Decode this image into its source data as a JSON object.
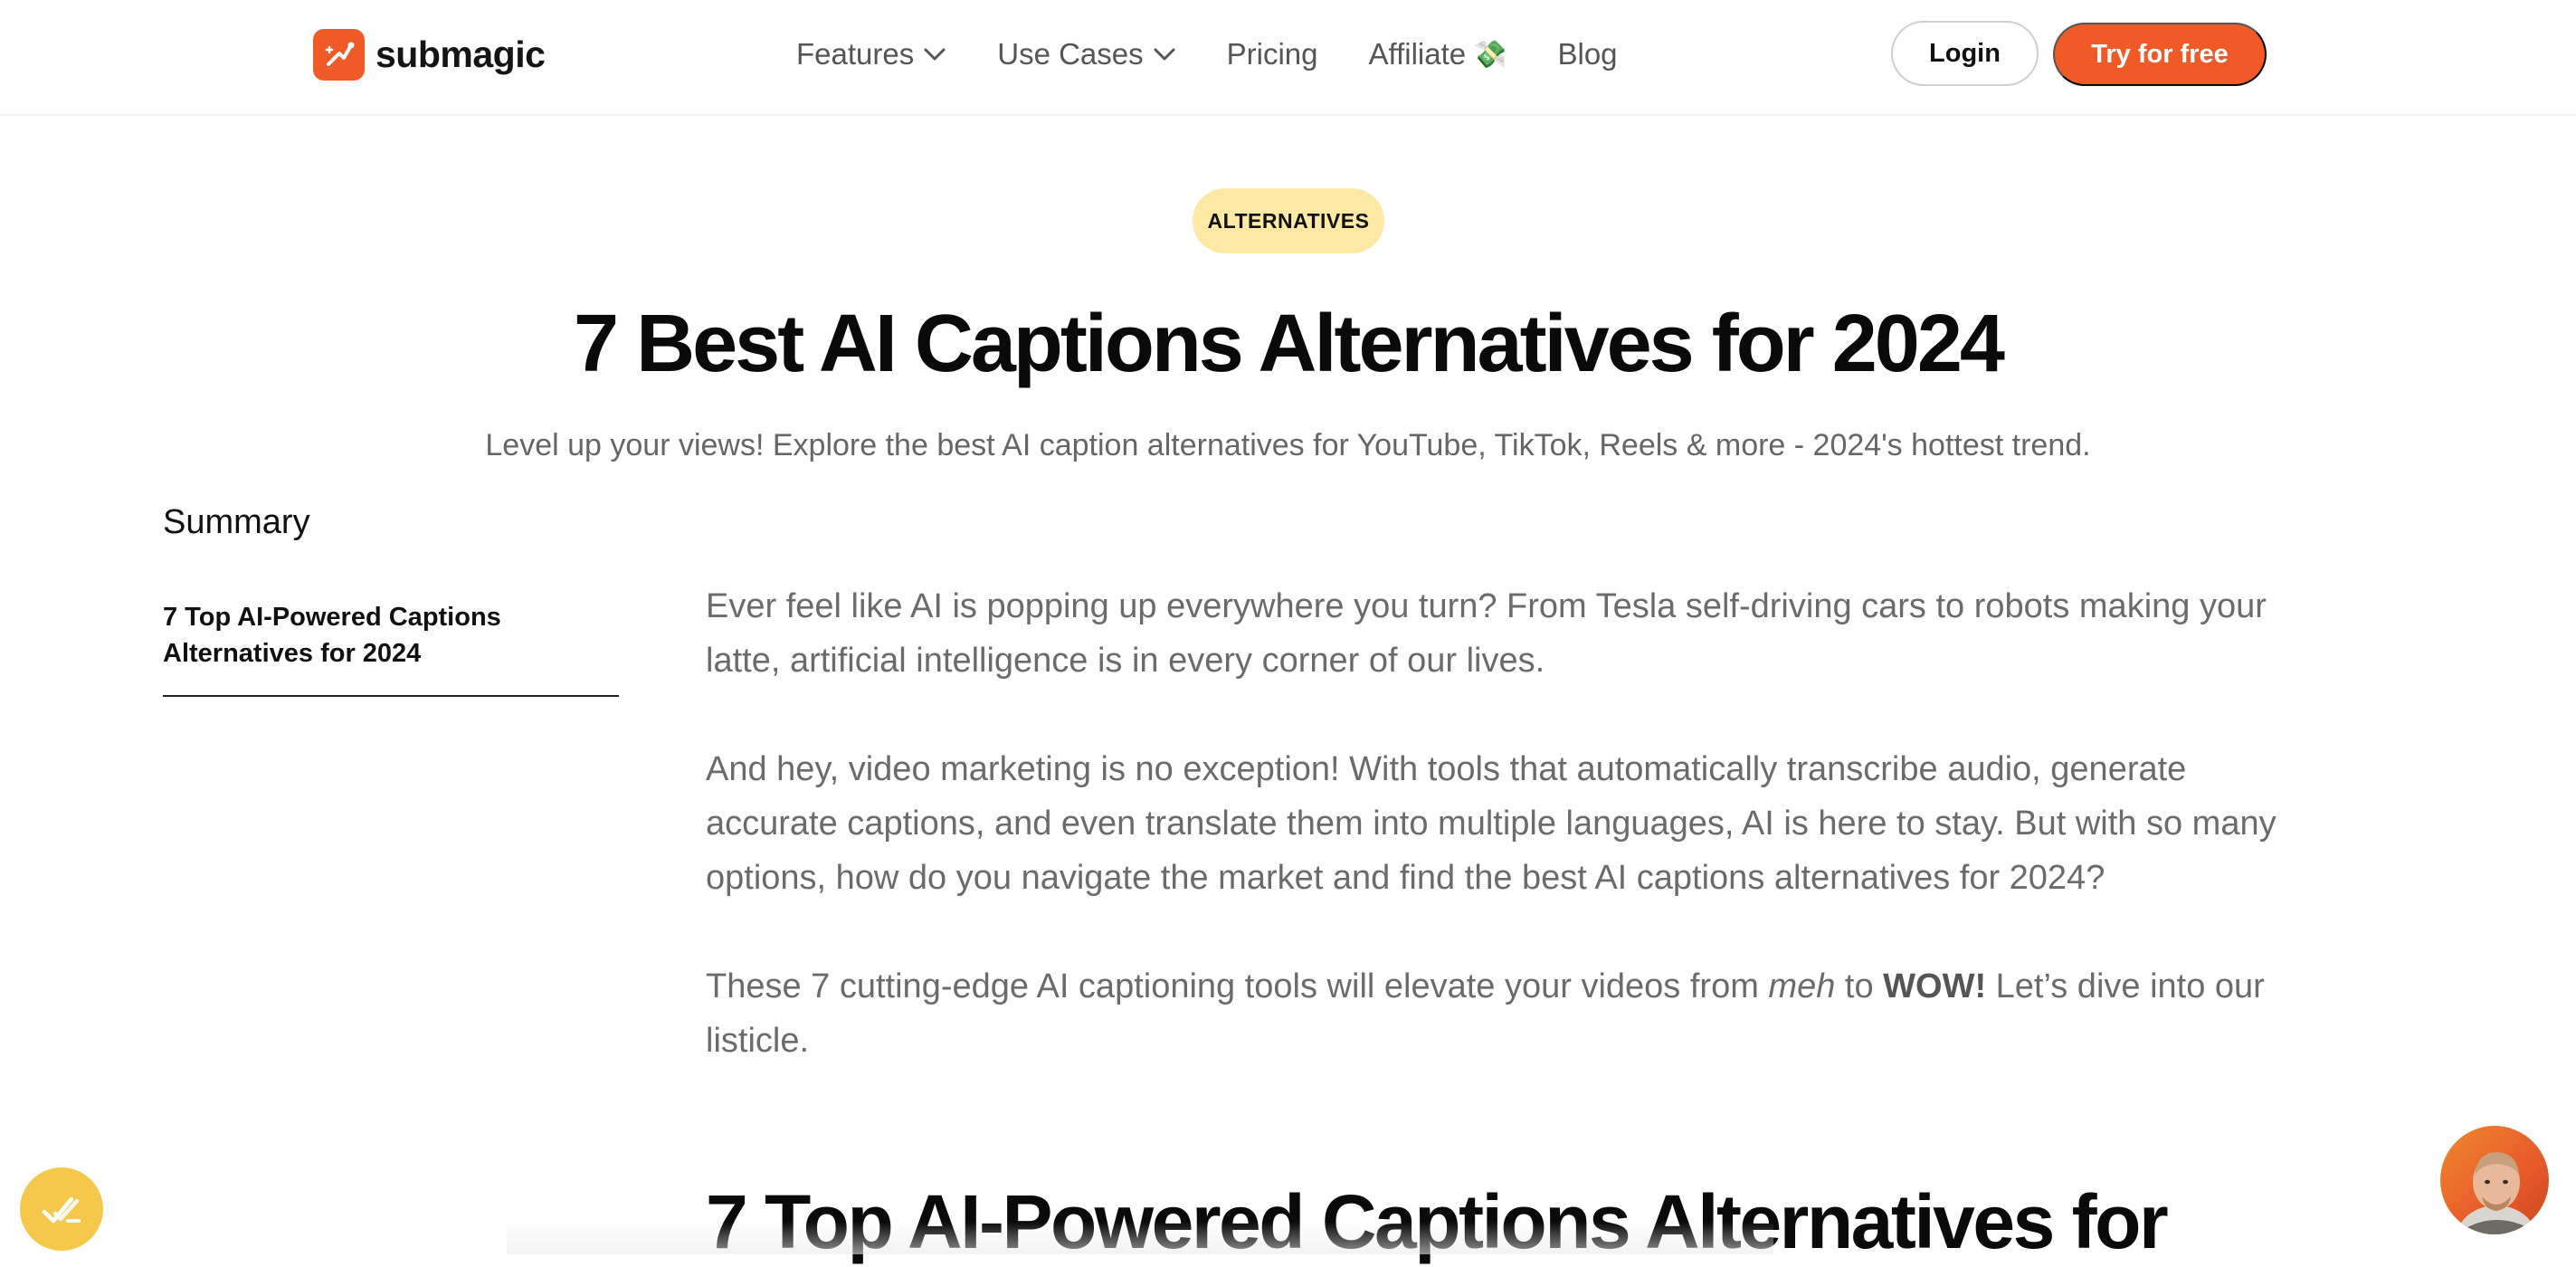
{
  "header": {
    "brand": "submagic",
    "nav": [
      {
        "label": "Features",
        "has_dropdown": true
      },
      {
        "label": "Use Cases",
        "has_dropdown": true
      },
      {
        "label": "Pricing",
        "has_dropdown": false
      },
      {
        "label": "Affiliate",
        "has_dropdown": false,
        "emoji": "💸"
      },
      {
        "label": "Blog",
        "has_dropdown": false
      }
    ],
    "login_label": "Login",
    "cta_label": "Try for free"
  },
  "hero": {
    "badge": "ALTERNATIVES",
    "title": "7 Best AI Captions Alternatives for 2024",
    "subtitle": "Level up your views! Explore the best AI caption alternatives for YouTube, TikTok, Reels & more - 2024's hottest trend."
  },
  "sidebar": {
    "title": "Summary",
    "items": [
      {
        "label": "7 Top AI-Powered Captions Alternatives for 2024"
      }
    ]
  },
  "article": {
    "paragraph_1": "Ever feel like AI is popping up everywhere you turn? From Tesla self-driving cars to robots making your latte, artificial intelligence is in every corner of our lives.",
    "paragraph_2": "And hey, video marketing is no exception! With tools that automatically transcribe audio, generate accurate captions, and even translate them into multiple languages, AI is here to stay. But with so many options, how do you navigate the market and find the best AI captions alternatives for 2024?",
    "paragraph_3": {
      "before": "These 7 cutting-edge AI captioning tools will elevate your videos from ",
      "em": "meh",
      "middle": " to ",
      "strong": "WOW!",
      "after": " Let’s dive into our listicle."
    },
    "section_heading": "7 Top AI-Powered Captions Alternatives for"
  },
  "colors": {
    "brand": "#ef5a26",
    "badge_bg": "#fde9a3",
    "body_text": "#6b6b6b",
    "widget_yellow": "#f5c84c"
  },
  "icons": {
    "logo": "submagic-logo-icon",
    "dropdown": "chevron-down-icon",
    "float_widget": "checkmark-sparkle-icon",
    "chat_avatar": "avatar"
  }
}
